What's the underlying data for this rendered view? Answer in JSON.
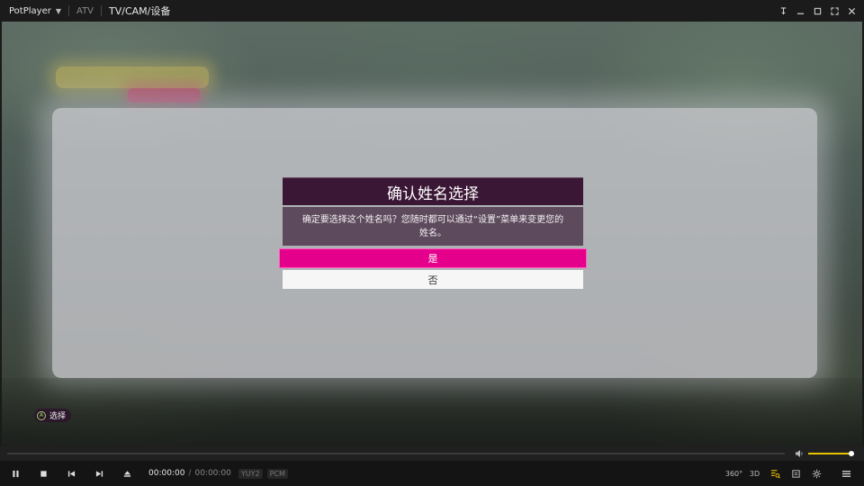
{
  "titlebar": {
    "app_name": "PotPlayer",
    "source": "ATV",
    "title": "TV/CAM/设备"
  },
  "dialog": {
    "title": "确认姓名选择",
    "message": "确定要选择这个姓名吗？您随时都可以通过“设置”菜单来变更您的姓名。",
    "yes_label": "是",
    "no_label": "否"
  },
  "hint": {
    "button": "A",
    "label": "选择"
  },
  "playback": {
    "current_time": "00:00:00",
    "separator": "/",
    "duration": "00:00:00",
    "video_format": "YUY2",
    "audio_format": "PCM",
    "progress": 0,
    "volume": 1.0
  },
  "right_controls": {
    "label_360": "360°",
    "label_3d": "3D"
  },
  "colors": {
    "accent_pink": "#e5008c",
    "dialog_title_bg": "#3b1736",
    "dialog_body_bg": "#5e4a5d",
    "volume_fill": "#e8c200"
  }
}
